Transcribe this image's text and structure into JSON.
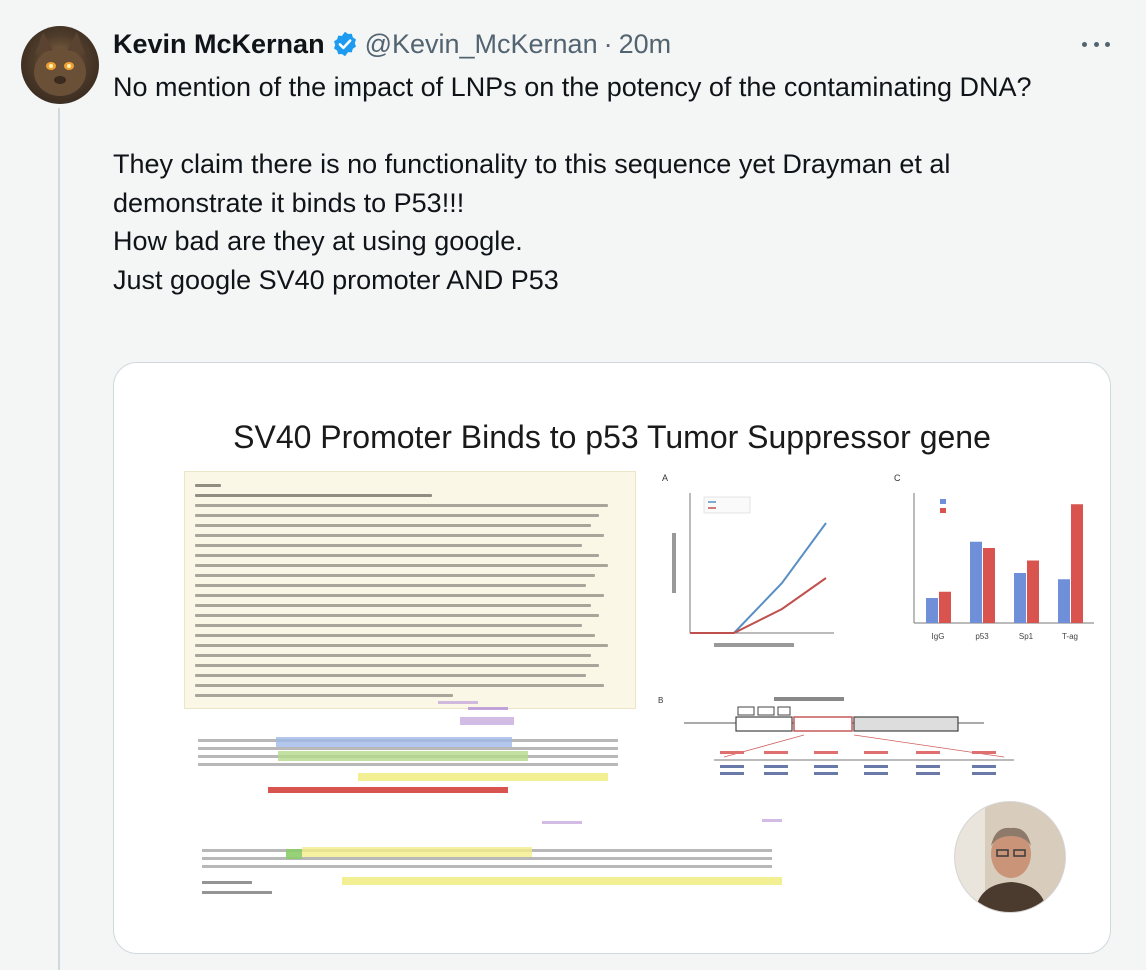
{
  "tweet": {
    "author_name": "Kevin McKernan",
    "handle": "@Kevin_McKernan",
    "separator": "·",
    "timestamp": "20m",
    "more_icon": "more-horizontal-icon",
    "verified_icon": "verified-badge-icon",
    "verified_color": "#1d9bf0",
    "text_lines": [
      "No mention of the impact of LNPs on the potency of the contaminating DNA?",
      "",
      "They claim there is no functionality to this sequence yet Drayman et al demonstrate it binds to P53!!!",
      "How bad are they at using google.",
      "Just google SV40 promoter AND P53"
    ]
  },
  "media": {
    "slide_title": "SV40 Promoter Binds to p53 Tumor Suppressor gene",
    "panel_letters": [
      "A",
      "C",
      "B"
    ],
    "chart_a": {
      "line_colors": [
        "#5a8fc4",
        "#c0504d"
      ]
    },
    "chart_c": {
      "categories": [
        "IgG",
        "p53",
        "Sp1",
        "T-ag"
      ],
      "bar_colors": [
        "#6f8fd8",
        "#d9534f"
      ]
    }
  }
}
